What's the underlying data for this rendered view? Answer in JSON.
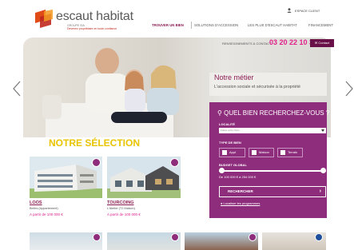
{
  "header": {
    "brand": "escaut habitat",
    "group": "GROUPE SIA",
    "tagline": "Devenez propriétaire en toute confiance",
    "client_link": "ESPACE CLIENT",
    "nav": [
      "TROUVER UN BIEN",
      "SOLUTIONS D'ACCESSION",
      "LES PLUS D'ESCAUT HABITAT",
      "FINANCEMENT"
    ]
  },
  "contact": {
    "line": "RENSEIGNEMENTS & CONTACT",
    "phone": "03 20 22 10 33",
    "button": "Contact"
  },
  "metier": {
    "title": "Notre métier",
    "subtitle": "L'accession sociale et sécurisée à la propriété"
  },
  "search": {
    "title": "QUEL BIEN RECHERCHEZ-VOUS ?",
    "locality_label": "LOCALITÉ",
    "locality_value": "Faites votre choix...",
    "type_label": "TYPE DE BIEN",
    "types": [
      "Appt",
      "Maison",
      "Terrain"
    ],
    "budget_label": "BUDGET GLOBAL",
    "budget_min_fraction": 0.0,
    "budget_max_fraction": 1.0,
    "budget_value": "De 100 000 € à 254 000 €",
    "submit": "RECHERCHER",
    "locate": "Localiser les programmes"
  },
  "selection": {
    "title": "NOTRE SÉLECTION",
    "cards": [
      {
        "name": "LOOS",
        "subtitle": "Belles (Appartement)",
        "price": "A partir de 100 000 €"
      },
      {
        "name": "TOURCOING",
        "subtitle": "L'Atelier (T2 Maison)",
        "price": "A partir de 100 000 €"
      }
    ]
  },
  "colors": {
    "brand": "#8b1c52",
    "accent": "#e0218a",
    "panel": "#8e2d7c",
    "selection_title": "#e9c400"
  }
}
